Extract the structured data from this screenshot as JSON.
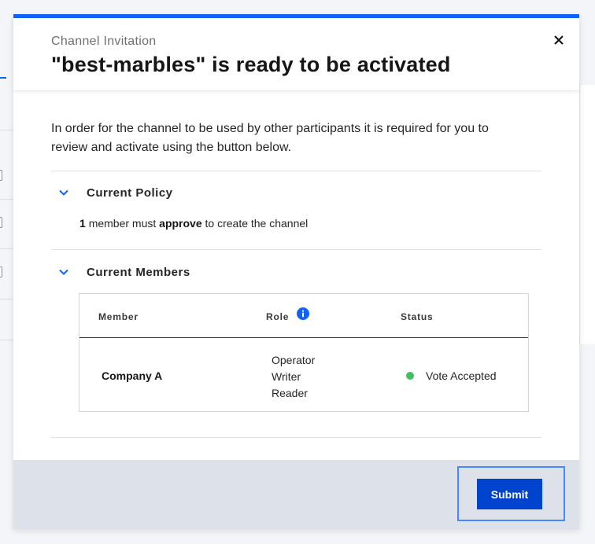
{
  "modal": {
    "eyebrow": "Channel Invitation",
    "title": "\"best-marbles\" is ready to be activated",
    "close_icon": "close-icon",
    "intro": "In order for the channel to be used by other participants it is required for you to review and activate using the button below."
  },
  "policy_section": {
    "label": "Current Policy",
    "count": "1",
    "text_a": "member must",
    "keyword": "approve",
    "text_b": "to create the channel"
  },
  "members_section": {
    "label": "Current Members",
    "columns": {
      "member": "Member",
      "role": "Role",
      "status": "Status"
    },
    "rows": [
      {
        "member": "Company A",
        "roles": [
          "Operator",
          "Writer",
          "Reader"
        ],
        "status": "Vote Accepted"
      }
    ]
  },
  "footer": {
    "submit_label": "Submit"
  },
  "colors": {
    "accent": "#0f62fe",
    "button": "#0043ce",
    "status_accepted": "#42be65",
    "footer_bg": "#dde2ea"
  },
  "icons": {
    "close": "close-icon",
    "chevron": "chevron-down-icon",
    "info": "info-icon",
    "status": "status-dot-icon"
  }
}
